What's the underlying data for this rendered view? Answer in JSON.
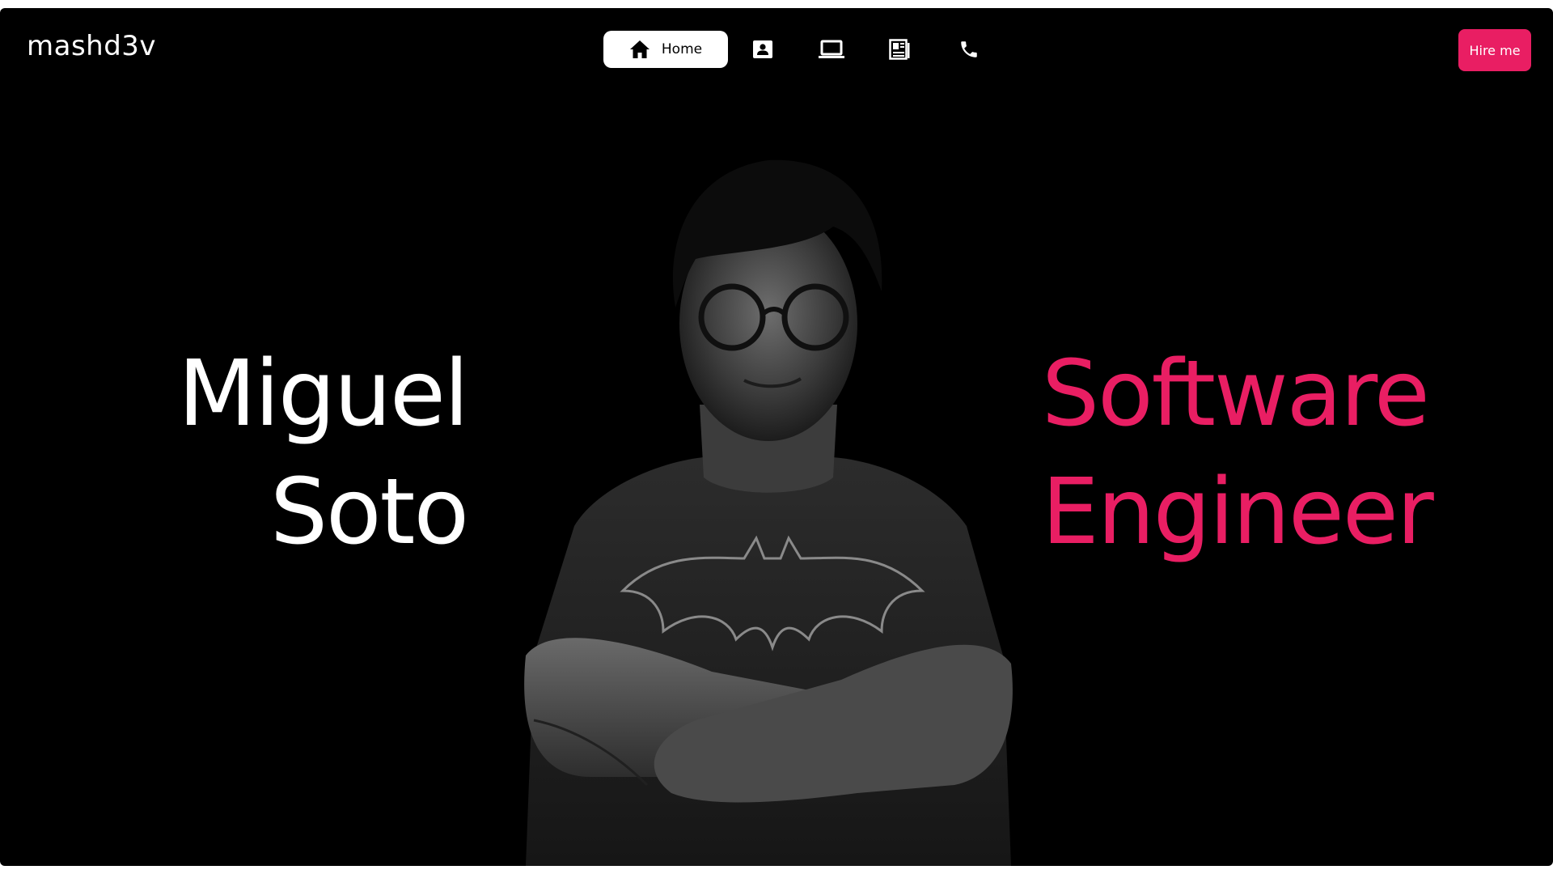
{
  "brand": {
    "logo_text": "mashd3v"
  },
  "nav": {
    "items": [
      {
        "label": "Home",
        "icon": "home-icon",
        "active": true
      },
      {
        "label": "",
        "icon": "contact-card-icon",
        "active": false
      },
      {
        "label": "",
        "icon": "laptop-icon",
        "active": false
      },
      {
        "label": "",
        "icon": "newspaper-icon",
        "active": false
      },
      {
        "label": "",
        "icon": "phone-icon",
        "active": false
      }
    ]
  },
  "cta": {
    "label": "Hire me"
  },
  "hero": {
    "first_name": "Miguel",
    "last_name": "Soto",
    "role_line1": "Software",
    "role_line2": "Engineer"
  },
  "colors": {
    "background": "#000000",
    "accent": "#e91e63",
    "text": "#ffffff"
  }
}
